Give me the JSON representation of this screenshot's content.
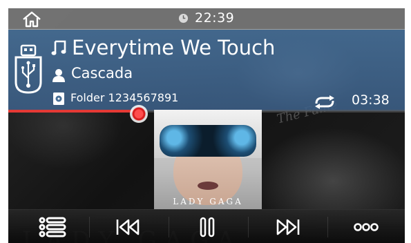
{
  "status": {
    "time": "22:39",
    "home_icon": "home-icon",
    "clock_icon": "clock-icon"
  },
  "track": {
    "title": "Everytime We Touch",
    "artist": "Cascada",
    "folder": "Folder 1234567891",
    "duration": "03:38",
    "progress": 0.33
  },
  "album": {
    "label": "LADY GAGA",
    "background_caption": "The Fame"
  },
  "controls": {
    "items": [
      {
        "name": "playlist-button",
        "icon": "list-icon"
      },
      {
        "name": "previous-track-button",
        "icon": "skip-back-icon"
      },
      {
        "name": "pause-button",
        "icon": "pause-icon"
      },
      {
        "name": "next-track-button",
        "icon": "skip-forward-icon"
      },
      {
        "name": "more-options-button",
        "icon": "more-icon"
      }
    ]
  },
  "colors": {
    "accent": "#e53935",
    "panel": "#466e96",
    "statusbar": "#787878"
  }
}
